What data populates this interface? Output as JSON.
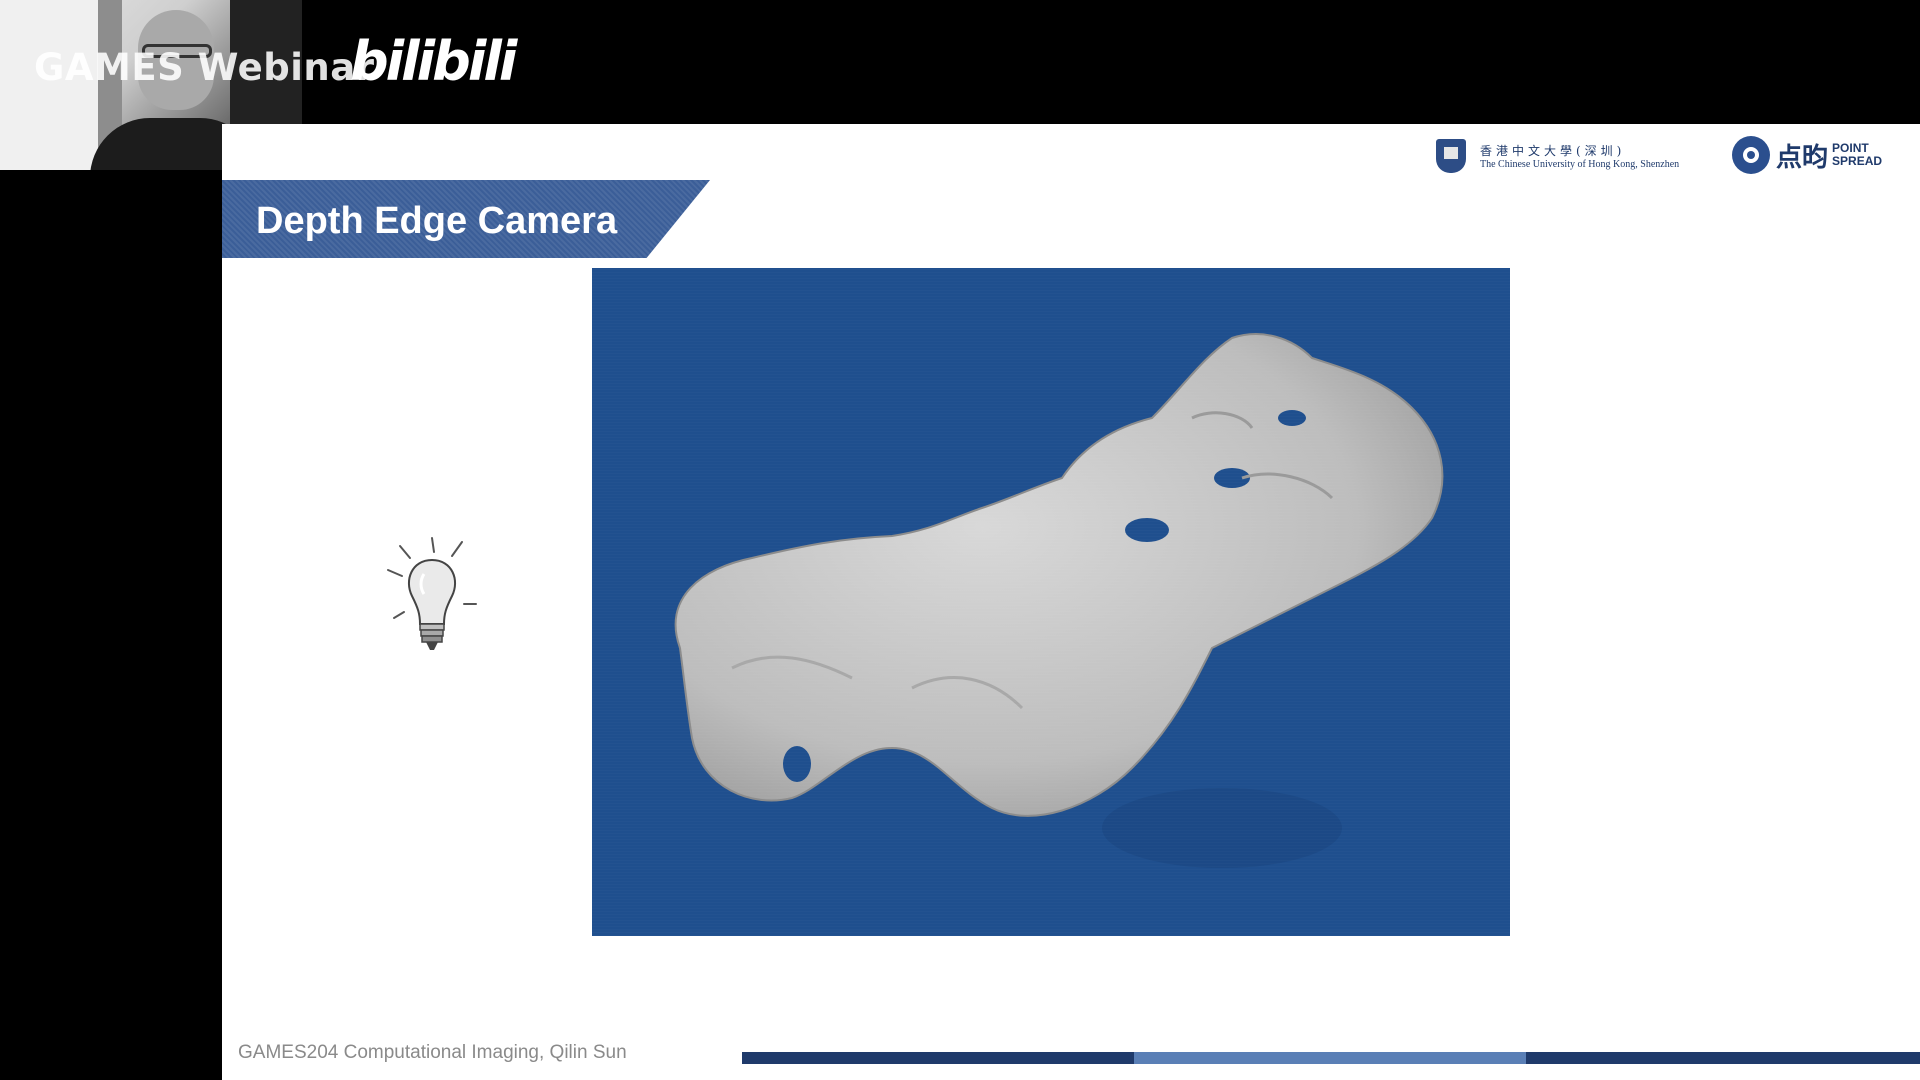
{
  "stream": {
    "brand": "GAMES Webinar",
    "platform": "bilibili"
  },
  "slide": {
    "title": "Depth Edge Camera",
    "footer": "GAMES204 Computational Imaging, Qilin Sun",
    "logos": {
      "cuhk_cn": "香港中文大學(深圳)",
      "cuhk_en": "The Chinese University of Hong Kong, Shenzhen",
      "pointspread_cn": "点昀",
      "pointspread_en_1": "POINT",
      "pointspread_en_2": "SPREAD"
    }
  },
  "colors": {
    "banner": "#3b5e98",
    "image_bg": "#1f4f8e",
    "accent_dark": "#1f3a6b"
  },
  "icons": [
    "lightbulb-icon",
    "webcam-presenter"
  ]
}
